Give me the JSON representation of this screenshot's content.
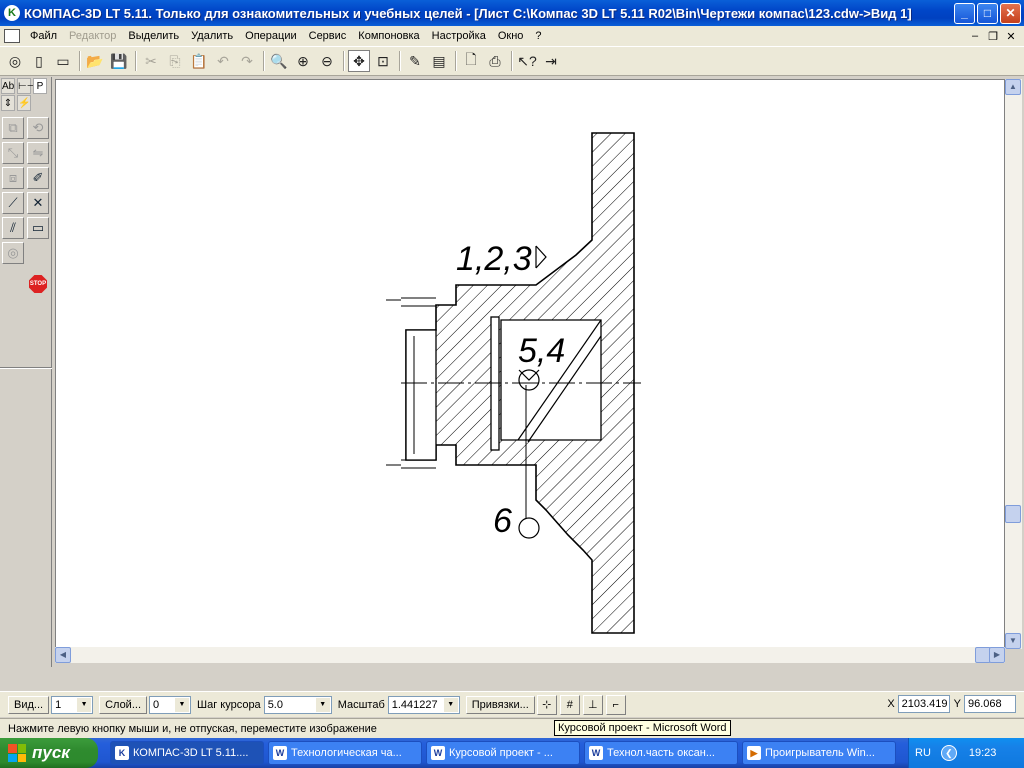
{
  "window": {
    "title": "КОМПАС-3D LT 5.11. Только для ознакомительных и учебных целей - [Лист C:\\Компас 3D LT 5.11 R02\\Bin\\Чертежи компас\\123.cdw->Вид 1]",
    "app_icon": "kompas-logo-icon",
    "controls": {
      "minimize": "_",
      "maximize": "□",
      "close": "✕"
    }
  },
  "menu": {
    "items": [
      "Файл",
      "Редактор",
      "Выделить",
      "Удалить",
      "Операции",
      "Сервис",
      "Компоновка",
      "Настройка",
      "Окно",
      "?"
    ],
    "disabled": [
      "Редактор"
    ]
  },
  "toolbar": {
    "icons": [
      "preview-icon",
      "new-sheet-icon",
      "new-document-icon",
      "open-icon",
      "save-icon",
      "cut-icon",
      "copy-icon",
      "paste-icon",
      "undo-icon",
      "redo-icon",
      "zoom-icon",
      "zoom-in-icon",
      "zoom-out-icon",
      "pan-icon",
      "zoom-frame-icon",
      "draw-icon",
      "format-icon",
      "print-preview-icon",
      "print-icon",
      "help-pointer-icon",
      "exit-icon"
    ]
  },
  "left_panel": {
    "tabs": [
      "Аb",
      "⊢⊣",
      "Р",
      "⇕",
      "⚡"
    ],
    "stop_label": "STOP"
  },
  "drawing": {
    "annotations": {
      "rough_marker": "1,2,3",
      "center_marker": "5,4",
      "bottom_marker": "6"
    }
  },
  "properties_bar": {
    "view_button": "Вид...",
    "view_value": "1",
    "layer_button": "Слой...",
    "layer_value": "0",
    "cursor_step_label": "Шаг курсора",
    "cursor_step_value": "5.0",
    "scale_label": "Масштаб",
    "scale_value": "1.441227",
    "snap_button": "Привязки...",
    "x_label": "X",
    "x_value": "2103.419",
    "y_label": "Y",
    "y_value": "96.068"
  },
  "status": {
    "hint": "Нажмите левую кнопку мыши и, не отпуская, переместите изображение",
    "tooltip": "Курсовой проект - Microsoft Word"
  },
  "taskbar": {
    "start_label": "пуск",
    "tasks": [
      {
        "label": "КОМПАС-3D LT 5.11....",
        "icon": "kompas-icon",
        "active": true
      },
      {
        "label": "Технологическая ча...",
        "icon": "word-icon",
        "active": false
      },
      {
        "label": "Курсовой проект - ...",
        "icon": "word-icon",
        "active": false
      },
      {
        "label": "Технол.часть оксан...",
        "icon": "word-icon",
        "active": false
      },
      {
        "label": "Проигрыватель Win...",
        "icon": "media-player-icon",
        "active": false
      }
    ],
    "language": "RU",
    "clock": "19:23"
  },
  "colors": {
    "title_bar": "#0a5fd8",
    "taskbar": "#245edb",
    "start_button": "#2f8b2f",
    "canvas": "#ffffff"
  }
}
